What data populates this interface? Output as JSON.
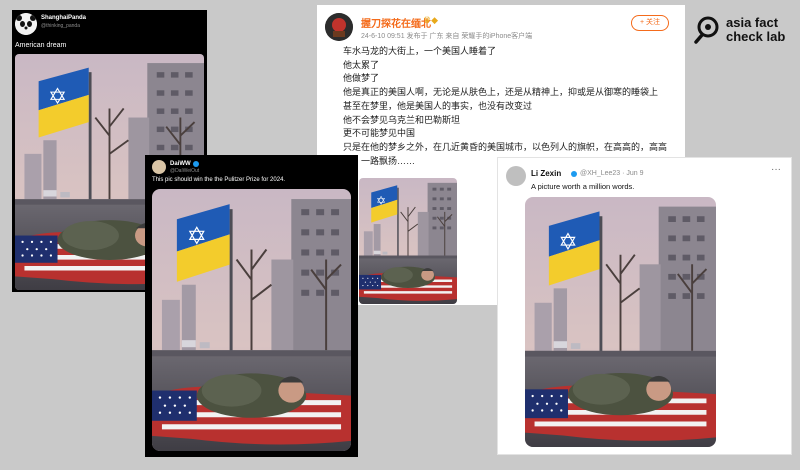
{
  "logo": {
    "line1": "asia fact",
    "line2": "check lab"
  },
  "posts": [
    {
      "platform": "x",
      "author": "ShanghaiPanda",
      "handle": "@thinking_panda",
      "text": "American dream"
    },
    {
      "platform": "x",
      "author": "DaiWW",
      "handle": "@DaiWeiOut",
      "text": "This pic should win the the Pulitzer Prize for 2024."
    },
    {
      "platform": "weibo",
      "author": "握刀探花在缅北",
      "meta": "24-6-10 09:51 发布于 广东 来自 荣耀手的iPhone客户端",
      "follow_label": "+ 关注",
      "lines": [
        "车水马龙的大街上，一个美国人睡着了",
        "他太累了",
        "他做梦了",
        "他是真正的美国人啊，无论是从肤色上，还是从精神上，抑或是从御寒的睡袋上",
        "甚至在梦里，他是美国人的事实，也没有改变过",
        "他不会梦见乌克兰和巴勒斯坦",
        "更不可能梦见中国",
        "只是在他的梦乡之外，在几近黄昏的美国城市，以色列人的旗帜，在高高的，高高",
        "的，一路飘扬……"
      ]
    },
    {
      "platform": "x",
      "author": "Li Zexin",
      "handle": "@XH_Lee23 · Jun 9",
      "text": "A picture worth a million words.",
      "more_label": "···"
    }
  ],
  "colors": {
    "background": "#c9c9c9",
    "weibo_accent": "#f46b1b",
    "verified": "#1d9bf0",
    "flag_blue": "#1f5bb5",
    "flag_yellow": "#f3cc2c"
  },
  "icons": [
    "panda-avatar-icon",
    "verified-badge-icon",
    "more-options-icon",
    "asia-fact-check-lab-logo-icon"
  ]
}
